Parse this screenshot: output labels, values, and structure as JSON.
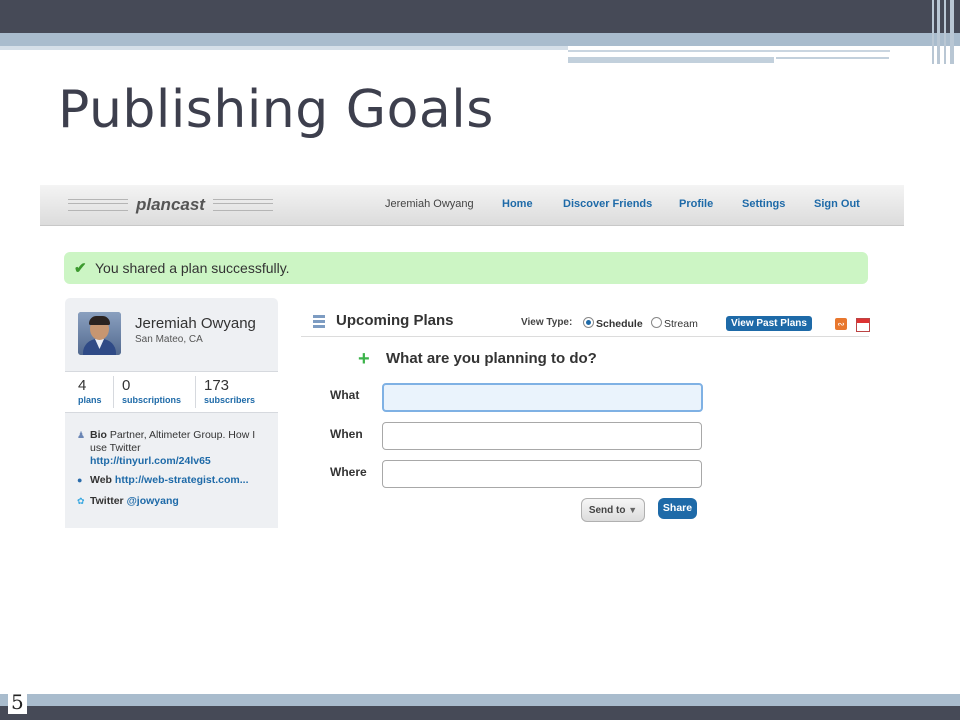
{
  "slide": {
    "title": "Publishing Goals",
    "number": "5"
  },
  "navbar": {
    "logo": "plancast",
    "user": "Jeremiah Owyang",
    "links": [
      "Home",
      "Discover Friends",
      "Profile",
      "Settings",
      "Sign Out"
    ]
  },
  "notice": {
    "text": "You shared a plan successfully."
  },
  "profile": {
    "name": "Jeremiah Owyang",
    "location": "San Mateo, CA",
    "stats": [
      {
        "value": "4",
        "label": "plans"
      },
      {
        "value": "0",
        "label": "subscriptions"
      },
      {
        "value": "173",
        "label": "subscribers"
      }
    ],
    "bio_label": "Bio",
    "bio_text": "Partner, Altimeter Group. How I",
    "bio_text2": "use Twitter",
    "bio_link": "http://tinyurl.com/24lv65",
    "web_label": "Web",
    "web_link": "http://web-strategist.com...",
    "twitter_label": "Twitter",
    "twitter_handle": "@jowyang"
  },
  "plans": {
    "title": "Upcoming Plans",
    "view_type_label": "View Type:",
    "options": [
      "Schedule",
      "Stream"
    ],
    "selected_option": "Schedule",
    "view_past": "View Past Plans"
  },
  "form": {
    "question": "What are you planning to do?",
    "labels": [
      "What",
      "When",
      "Where"
    ],
    "values": [
      "",
      "",
      ""
    ],
    "send_to": "Send to",
    "share": "Share"
  },
  "colors": {
    "slide_dark": "#464a57",
    "slide_light": "#a9bccd",
    "link_blue": "#1e6aa8",
    "success_bg": "#ccf5c4"
  }
}
